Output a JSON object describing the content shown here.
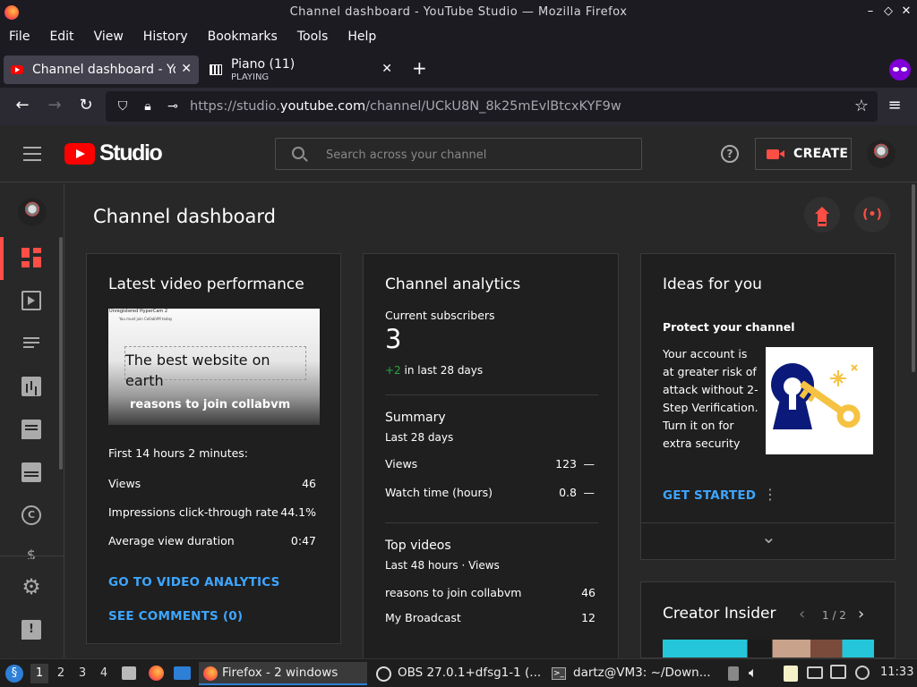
{
  "window": {
    "title": "Channel dashboard - YouTube Studio — Mozilla Firefox",
    "controls": [
      "–",
      "◇",
      "✕"
    ]
  },
  "menu": [
    "File",
    "Edit",
    "View",
    "History",
    "Bookmarks",
    "Tools",
    "Help"
  ],
  "tabs": [
    {
      "label": "Channel dashboard - YouTube Studio",
      "close": "✕"
    },
    {
      "label": "Piano (11)",
      "sublabel": "PLAYING",
      "close": "✕"
    }
  ],
  "new_tab": "+",
  "urlbar": {
    "prefix": "https://studio.",
    "domain": "youtube.com",
    "path": "/channel/UCkU8N_8k25mEvlBtcxKYF9w"
  },
  "header": {
    "brand": "Studio",
    "search_placeholder": "Search across your channel",
    "help": "?",
    "create_label": "CREATE"
  },
  "page_title": "Channel dashboard",
  "latest_video": {
    "title": "Latest video performance",
    "thumb_title_small": "Unregistered HyperCam 2",
    "thumb_subtitle_small": "You must join CollabVM today",
    "thumb_text": "The best website on earth",
    "thumb_caption": "reasons to join collabvm",
    "period": "First 14 hours 2 minutes:",
    "stats": [
      {
        "label": "Views",
        "value": "46"
      },
      {
        "label": "Impressions click-through rate",
        "value": "44.1%"
      },
      {
        "label": "Average view duration",
        "value": "0:47"
      }
    ],
    "analytics_link": "GO TO VIDEO ANALYTICS",
    "comments_link": "SEE COMMENTS (0)"
  },
  "analytics": {
    "title": "Channel analytics",
    "subs_label": "Current subscribers",
    "subs_value": "3",
    "subs_change": "+2",
    "subs_change_suffix": " in last 28 days",
    "summary_title": "Summary",
    "summary_period": "Last 28 days",
    "summary": [
      {
        "label": "Views",
        "value": "123",
        "trend": "—"
      },
      {
        "label": "Watch time (hours)",
        "value": "0.8",
        "trend": "—"
      }
    ],
    "top_title": "Top videos",
    "top_period": "Last 48 hours · Views",
    "top": [
      {
        "label": "reasons to join collabvm",
        "value": "46"
      },
      {
        "label": "My Broadcast",
        "value": "12"
      }
    ]
  },
  "ideas": {
    "title": "Ideas for you",
    "subtitle": "Protect your channel",
    "body": "Your account is at greater risk of attack without 2-Step Verification. Turn it on for extra security",
    "cta": "GET STARTED",
    "more": "⋮",
    "expand": "⌄"
  },
  "insider": {
    "title": "Creator Insider",
    "pager": "1 / 2",
    "prev": "‹",
    "next": "›"
  },
  "taskbar": {
    "workspaces": [
      "1",
      "2",
      "3",
      "4"
    ],
    "apps": [
      "Firefox - 2 windows",
      "OBS 27.0.1+dfsg1-1 (...",
      "dartz@VM3: ~/Down..."
    ],
    "clock": "11:33"
  },
  "colors": {
    "accent_red": "#ff4e45",
    "link_blue": "#3ea6ff",
    "positive_green": "#2ba640",
    "card_bg": "#1f1f1f",
    "page_bg": "#282828"
  }
}
